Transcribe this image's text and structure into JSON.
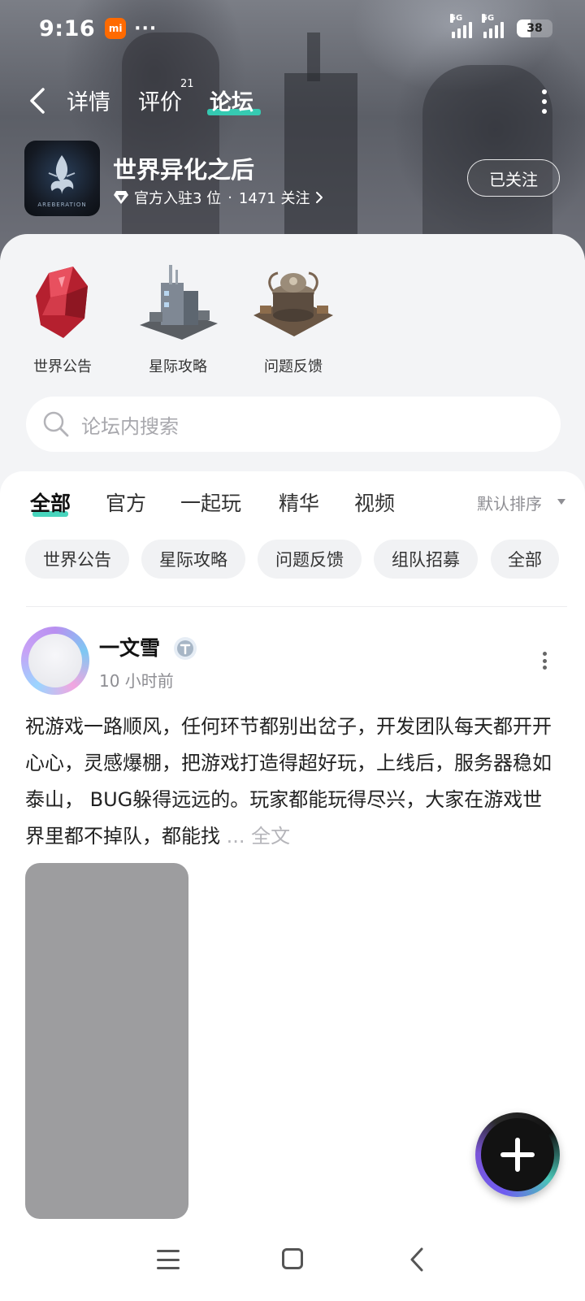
{
  "status_bar": {
    "time": "9:16",
    "mi_label": "mi",
    "more": "···",
    "signal1_label": "5G",
    "signal2_label": "5G",
    "battery": "38",
    "battery_level": 0.38
  },
  "nav": {
    "tabs": [
      {
        "label": "详情"
      },
      {
        "label": "评价",
        "badge": "21"
      },
      {
        "label": "论坛",
        "active": true
      }
    ]
  },
  "game": {
    "title": "世界异化之后",
    "logo_text": "AREBERATION",
    "meta_rank": "官方入驻3 位",
    "meta_separator": "·",
    "meta_followers": "1471 关注",
    "follow_label": "已关注"
  },
  "categories": [
    {
      "label": "世界公告",
      "icon": "red-crystal-icon"
    },
    {
      "label": "星际攻略",
      "icon": "tower-building-icon"
    },
    {
      "label": "问题反馈",
      "icon": "machine-base-icon"
    }
  ],
  "search": {
    "placeholder": "论坛内搜索"
  },
  "feed_tabs": [
    {
      "label": "全部",
      "active": true
    },
    {
      "label": "官方"
    },
    {
      "label": "一起玩"
    },
    {
      "label": "精华"
    },
    {
      "label": "视频"
    }
  ],
  "sort_label": "默认排序",
  "chips": [
    "世界公告",
    "星际攻略",
    "问题反馈",
    "组队招募",
    "全部"
  ],
  "post": {
    "author": "一文雪",
    "time": "10 小时前",
    "text": "祝游戏一路顺风，任何环节都别出岔子，开发团队每天都开开心心，灵感爆棚，把游戏打造得超好玩，上线后，服务器稳如泰山， BUG躲得远远的。玩家都能玩得尽兴，大家在游戏世界里都不掉队，都能找",
    "ellipsis": "...",
    "full_label": "全文"
  },
  "colors": {
    "accent": "#34d0b6",
    "fab_purple": "#6f5cf0",
    "mi_orange": "#ff6a00"
  }
}
